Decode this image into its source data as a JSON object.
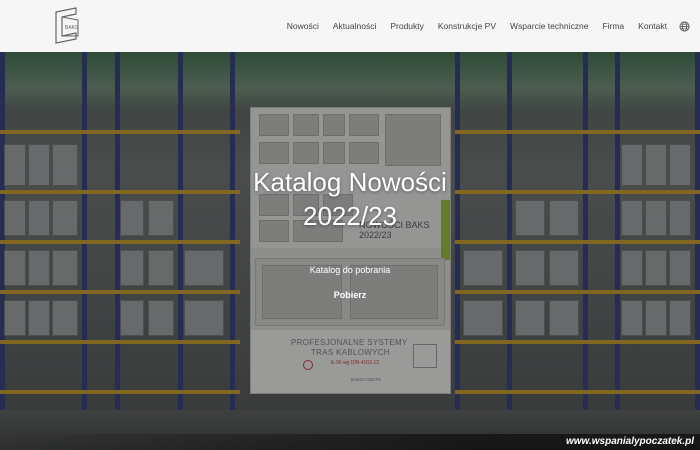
{
  "header": {
    "logo_icon": "baks-logo-icon",
    "nav": [
      {
        "label": "Nowości"
      },
      {
        "label": "Aktualności"
      },
      {
        "label": "Produkty"
      },
      {
        "label": "Konstrukcje PV"
      },
      {
        "label": "Wsparcie techniczne"
      },
      {
        "label": "Firma"
      },
      {
        "label": "Kontakt"
      }
    ],
    "language_icon": "globe-icon"
  },
  "hero": {
    "title_line1": "Katalog Nowości",
    "title_line2": "2022/23",
    "subtitle": "Katalog do pobrania",
    "button_label": "Pobierz",
    "catalog_cover": {
      "brand": "NOWOŚCI BAKS",
      "year": "2022/23",
      "line1": "PROFESJONALNE SYSTEMY",
      "line2": "TRAS KABLOWYCH",
      "norm": "E-90 wg DIN 4102-12",
      "url": "BAKS.COM.PL"
    }
  },
  "watermark": {
    "text": "www.wspanialypoczatek.pl"
  }
}
